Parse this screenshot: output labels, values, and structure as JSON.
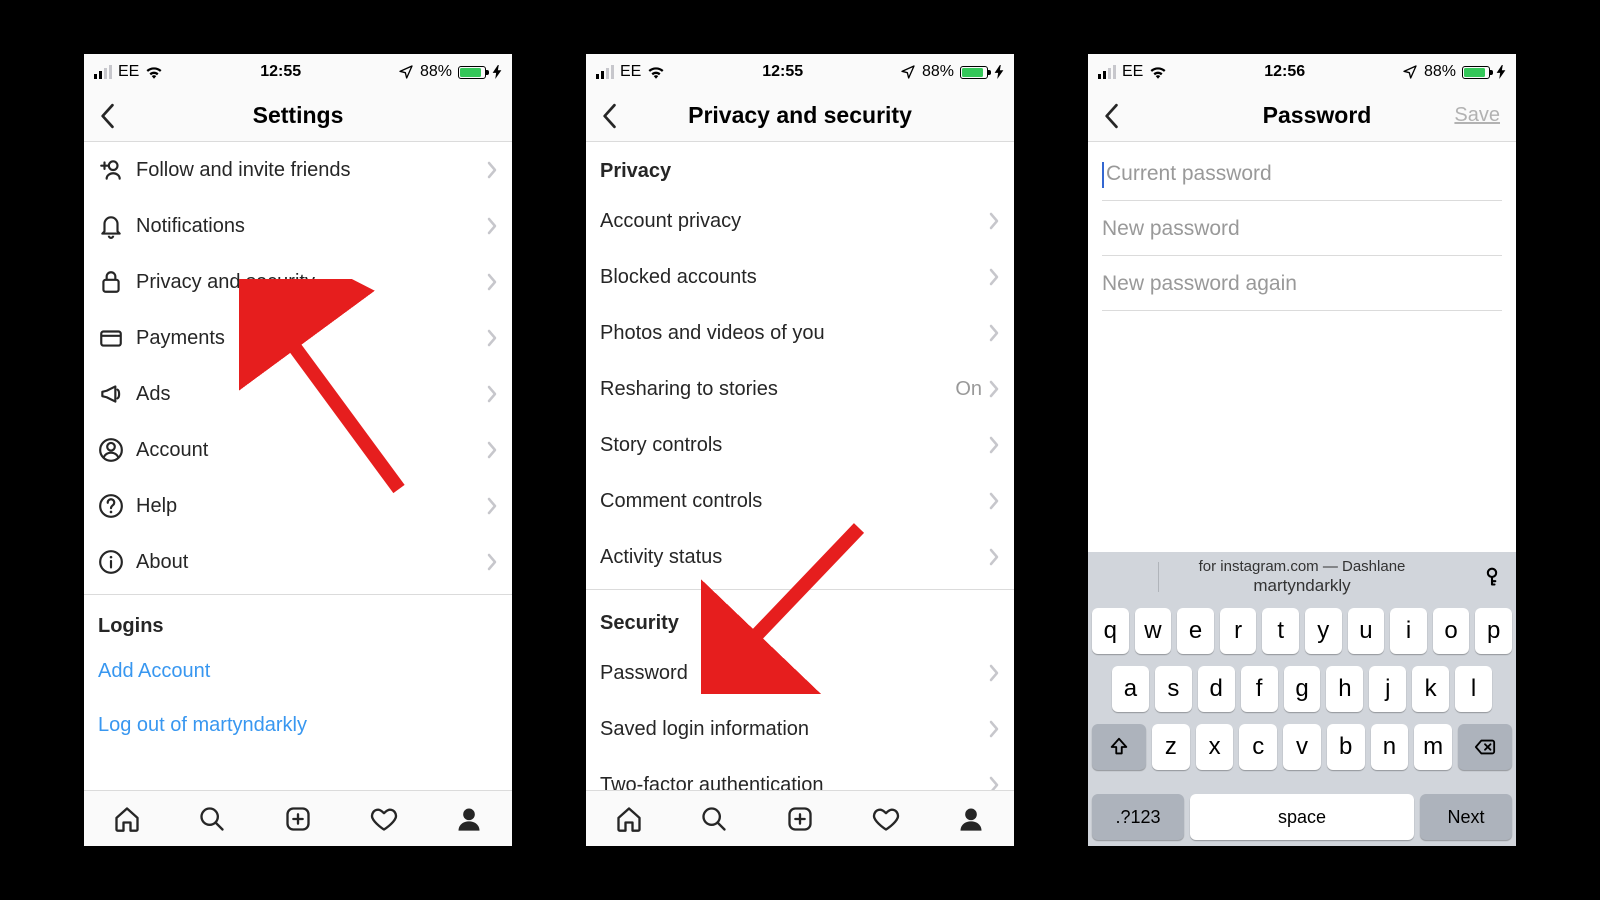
{
  "status": {
    "carrier": "EE",
    "time_a": "12:55",
    "time_b": "12:55",
    "time_c": "12:56",
    "battery_pct": "88%"
  },
  "screen1": {
    "title": "Settings",
    "items": [
      {
        "icon": "follow-invite-icon",
        "label": "Follow and invite friends"
      },
      {
        "icon": "bell-icon",
        "label": "Notifications"
      },
      {
        "icon": "lock-icon",
        "label": "Privacy and security"
      },
      {
        "icon": "card-icon",
        "label": "Payments"
      },
      {
        "icon": "megaphone-icon",
        "label": "Ads"
      },
      {
        "icon": "account-icon",
        "label": "Account"
      },
      {
        "icon": "help-icon",
        "label": "Help"
      },
      {
        "icon": "about-icon",
        "label": "About"
      }
    ],
    "logins_header": "Logins",
    "add_account": "Add Account",
    "logout": "Log out of martyndarkly"
  },
  "screen2": {
    "title": "Privacy and security",
    "privacy_header": "Privacy",
    "privacy_items": [
      {
        "label": "Account privacy"
      },
      {
        "label": "Blocked accounts"
      },
      {
        "label": "Photos and videos of you"
      },
      {
        "label": "Resharing to stories",
        "value": "On"
      },
      {
        "label": "Story controls"
      },
      {
        "label": "Comment controls"
      },
      {
        "label": "Activity status"
      }
    ],
    "security_header": "Security",
    "security_items": [
      {
        "label": "Password"
      },
      {
        "label": "Saved login information"
      },
      {
        "label": "Two-factor authentication"
      }
    ]
  },
  "screen3": {
    "title": "Password",
    "save": "Save",
    "placeholders": {
      "current": "Current password",
      "new": "New password",
      "again": "New password again"
    },
    "keyboard": {
      "suggest_top": "for instagram.com — Dashlane",
      "suggest_bottom": "martyndarkly",
      "row1": [
        "q",
        "w",
        "e",
        "r",
        "t",
        "y",
        "u",
        "i",
        "o",
        "p"
      ],
      "row2": [
        "a",
        "s",
        "d",
        "f",
        "g",
        "h",
        "j",
        "k",
        "l"
      ],
      "row3": [
        "z",
        "x",
        "c",
        "v",
        "b",
        "n",
        "m"
      ],
      "ctrl_123": ".?123",
      "space": "space",
      "next": "Next"
    }
  }
}
